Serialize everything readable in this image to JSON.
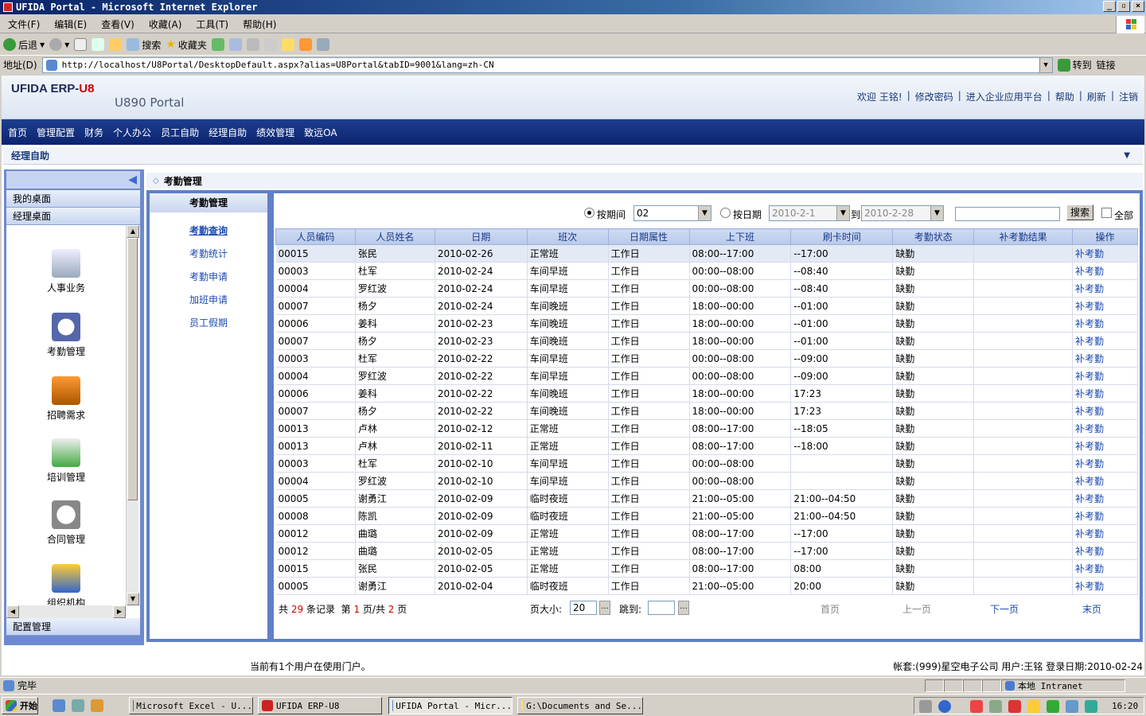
{
  "window": {
    "title": "UFIDA Portal - Microsoft Internet Explorer",
    "controls": [
      "_",
      "▫",
      "×"
    ]
  },
  "menubar": [
    "文件(F)",
    "编辑(E)",
    "查看(V)",
    "收藏(A)",
    "工具(T)",
    "帮助(H)"
  ],
  "toolbar": {
    "back": "后退",
    "search": "搜索",
    "favorites": "收藏夹"
  },
  "address": {
    "label": "地址(D)",
    "url": "http://localhost/U8Portal/DesktopDefault.aspx?alias=U8Portal&tabID=9001&lang=zh-CN",
    "go": "转到",
    "links": "链接"
  },
  "portal": {
    "logo_left": "UFIDA ERP-",
    "logo_right": "U8",
    "logo_sub": "U890 Portal",
    "toplinks": [
      "欢迎 王铭!",
      "|",
      "修改密码",
      "|",
      "进入企业应用平台",
      "|",
      "帮助",
      "|",
      "刷新",
      "|",
      "注销"
    ],
    "nav": [
      "首页",
      "管理配置",
      "财务",
      "个人办公",
      "员工自助",
      "经理自助",
      "绩效管理",
      "致远OA"
    ],
    "subheader": "经理自助"
  },
  "leftpanel": {
    "sections": [
      "我的桌面",
      "经理桌面"
    ],
    "icons": [
      {
        "label": "人事业务",
        "icon": "hr-doc-icon"
      },
      {
        "label": "考勤管理",
        "icon": "clock-calendar-icon"
      },
      {
        "label": "招聘需求",
        "icon": "mailbox-icon"
      },
      {
        "label": "培训管理",
        "icon": "training-doc-icon"
      },
      {
        "label": "合同管理",
        "icon": "magnifier-doc-icon"
      },
      {
        "label": "组织机构",
        "icon": "org-chart-icon"
      }
    ],
    "bottom": "配置管理"
  },
  "module": {
    "title": "考勤管理",
    "subnav_title": "考勤管理",
    "subnav": [
      "考勤查询",
      "考勤统计",
      "考勤申请",
      "加班申请",
      "员工假期"
    ]
  },
  "filters": {
    "by_period": "按期间",
    "period_value": "02",
    "by_date": "按日期",
    "date_from": "2010-2-1",
    "to": "到",
    "date_to": "2010-2-28",
    "search_value": "",
    "search_btn": "搜索",
    "all": "全部"
  },
  "table": {
    "columns": [
      "人员编码",
      "人员姓名",
      "日期",
      "班次",
      "日期属性",
      "上下班",
      "刷卡时间",
      "考勤状态",
      "补考勤结果",
      "操作"
    ],
    "rows": [
      [
        "00015",
        "张民",
        "2010-02-26",
        "正常班",
        "工作日",
        "08:00--17:00",
        "--17:00",
        "缺勤",
        "",
        "补考勤"
      ],
      [
        "00003",
        "杜军",
        "2010-02-24",
        "车间早班",
        "工作日",
        "00:00--08:00",
        "--08:40",
        "缺勤",
        "",
        "补考勤"
      ],
      [
        "00004",
        "罗红波",
        "2010-02-24",
        "车间早班",
        "工作日",
        "00:00--08:00",
        "--08:40",
        "缺勤",
        "",
        "补考勤"
      ],
      [
        "00007",
        "杨夕",
        "2010-02-24",
        "车间晚班",
        "工作日",
        "18:00--00:00",
        "--01:00",
        "缺勤",
        "",
        "补考勤"
      ],
      [
        "00006",
        "姜科",
        "2010-02-23",
        "车间晚班",
        "工作日",
        "18:00--00:00",
        "--01:00",
        "缺勤",
        "",
        "补考勤"
      ],
      [
        "00007",
        "杨夕",
        "2010-02-23",
        "车间晚班",
        "工作日",
        "18:00--00:00",
        "--01:00",
        "缺勤",
        "",
        "补考勤"
      ],
      [
        "00003",
        "杜军",
        "2010-02-22",
        "车间早班",
        "工作日",
        "00:00--08:00",
        "--09:00",
        "缺勤",
        "",
        "补考勤"
      ],
      [
        "00004",
        "罗红波",
        "2010-02-22",
        "车间早班",
        "工作日",
        "00:00--08:00",
        "--09:00",
        "缺勤",
        "",
        "补考勤"
      ],
      [
        "00006",
        "姜科",
        "2010-02-22",
        "车间晚班",
        "工作日",
        "18:00--00:00",
        "17:23",
        "缺勤",
        "",
        "补考勤"
      ],
      [
        "00007",
        "杨夕",
        "2010-02-22",
        "车间晚班",
        "工作日",
        "18:00--00:00",
        "17:23",
        "缺勤",
        "",
        "补考勤"
      ],
      [
        "00013",
        "卢林",
        "2010-02-12",
        "正常班",
        "工作日",
        "08:00--17:00",
        "--18:05",
        "缺勤",
        "",
        "补考勤"
      ],
      [
        "00013",
        "卢林",
        "2010-02-11",
        "正常班",
        "工作日",
        "08:00--17:00",
        "--18:00",
        "缺勤",
        "",
        "补考勤"
      ],
      [
        "00003",
        "杜军",
        "2010-02-10",
        "车间早班",
        "工作日",
        "00:00--08:00",
        "",
        "缺勤",
        "",
        "补考勤"
      ],
      [
        "00004",
        "罗红波",
        "2010-02-10",
        "车间早班",
        "工作日",
        "00:00--08:00",
        "",
        "缺勤",
        "",
        "补考勤"
      ],
      [
        "00005",
        "谢勇江",
        "2010-02-09",
        "临时夜班",
        "工作日",
        "21:00--05:00",
        "21:00--04:50",
        "缺勤",
        "",
        "补考勤"
      ],
      [
        "00008",
        "陈凯",
        "2010-02-09",
        "临时夜班",
        "工作日",
        "21:00--05:00",
        "21:00--04:50",
        "缺勤",
        "",
        "补考勤"
      ],
      [
        "00012",
        "曲璐",
        "2010-02-09",
        "正常班",
        "工作日",
        "08:00--17:00",
        "--17:00",
        "缺勤",
        "",
        "补考勤"
      ],
      [
        "00012",
        "曲璐",
        "2010-02-05",
        "正常班",
        "工作日",
        "08:00--17:00",
        "--17:00",
        "缺勤",
        "",
        "补考勤"
      ],
      [
        "00015",
        "张民",
        "2010-02-05",
        "正常班",
        "工作日",
        "08:00--17:00",
        "08:00",
        "缺勤",
        "",
        "补考勤"
      ],
      [
        "00005",
        "谢勇江",
        "2010-02-04",
        "临时夜班",
        "工作日",
        "21:00--05:00",
        "20:00",
        "缺勤",
        "",
        "补考勤"
      ]
    ]
  },
  "pager": {
    "total_prefix": "共",
    "total": "29",
    "total_suffix": "条记录",
    "page_prefix": "第",
    "page": "1",
    "page_mid": "页/共",
    "pages": "2",
    "page_suffix": "页",
    "size_label": "页大小:",
    "size_value": "20",
    "jump_label": "跳到:",
    "jump_value": "",
    "first": "首页",
    "prev": "上一页",
    "next": "下一页",
    "last": "末页"
  },
  "footer": {
    "users": "当前有1个用户在使用门户。",
    "account": "帐套:(999)星空电子公司 用户:王铭 登录日期:2010-02-24"
  },
  "statusbar": {
    "status": "完毕",
    "zone": "本地 Intranet"
  },
  "taskbar": {
    "start": "开始",
    "buttons": [
      "Microsoft Excel - U...",
      "UFIDA ERP-U8",
      "UFIDA Portal - Micr...",
      "G:\\Documents and Se..."
    ],
    "clock": "16:20"
  },
  "colors": {
    "nav_bg": "#1c3e8e",
    "link": "#1a4bb0",
    "accent_red": "#cc0000",
    "header_blue": "#1a3a8a"
  }
}
